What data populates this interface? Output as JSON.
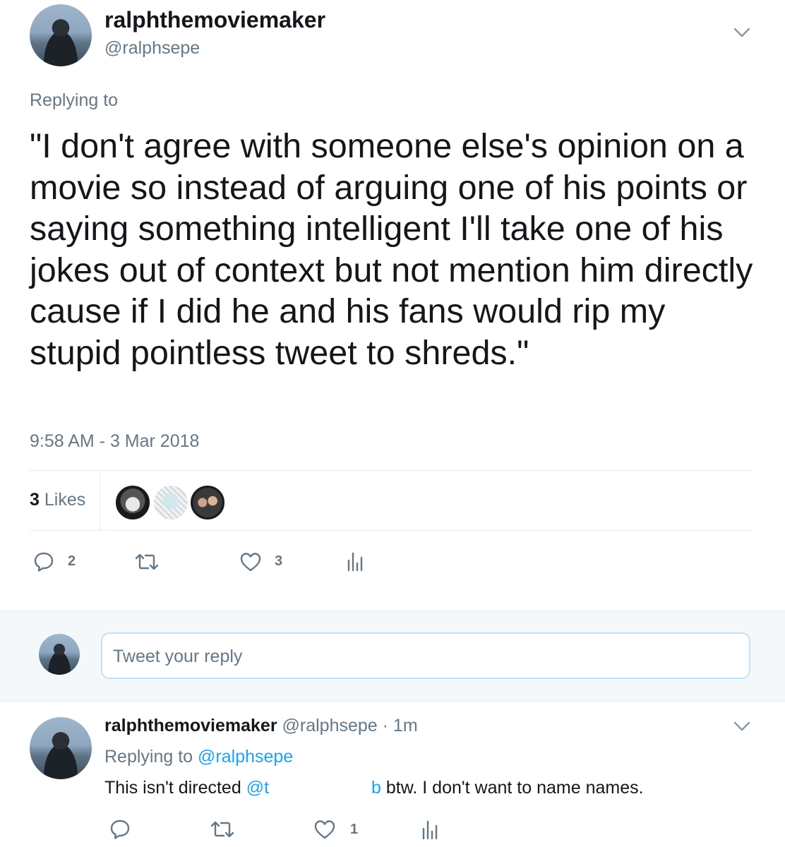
{
  "tweet": {
    "display_name": "ralphthemoviemaker",
    "handle": "@ralphsepe",
    "replying_to": "Replying to",
    "text": "\"I don't agree with someone else's opinion on a movie so instead of arguing one of his points or saying something intelligent I'll take one of his jokes out of context but not mention him directly cause if I did he and his fans would rip my stupid pointless tweet to shreds.\"",
    "timestamp": "9:58 AM - 3 Mar 2018",
    "likes_count": "3",
    "likes_label": "Likes",
    "actions": {
      "reply_count": "2",
      "like_count": "3"
    }
  },
  "reply_box": {
    "placeholder": "Tweet your reply"
  },
  "reply": {
    "display_name": "ralphthemoviemaker",
    "handle": "@ralphsepe",
    "time": "· 1m",
    "replying_prefix": "Replying to",
    "replying_handle": "@ralphsepe",
    "text_start": "This isn't directed",
    "mention_start": "@t",
    "mention_end": "b",
    "text_end": "btw. I don't want to name names.",
    "actions": {
      "like_count": "1"
    }
  },
  "colors": {
    "accent": "#1da1f2",
    "muted": "#657786",
    "divider": "#e6ecf0",
    "reply_bg": "#f5f8fa"
  }
}
